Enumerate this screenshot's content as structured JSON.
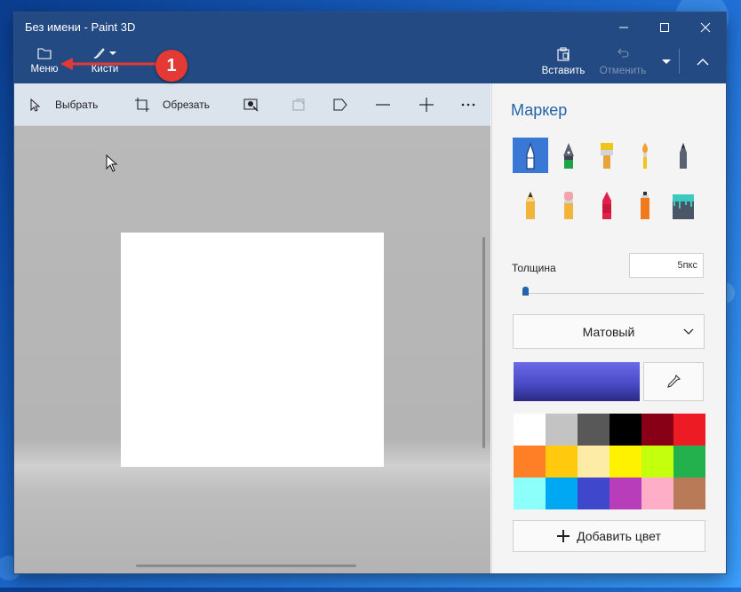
{
  "window": {
    "title": "Без имени - Paint 3D"
  },
  "ribbon": {
    "menu_label": "Меню",
    "brushes_label": "Кисти",
    "paste_label": "Вставить",
    "undo_label": "Отменить"
  },
  "toolbar": {
    "select_label": "Выбрать",
    "crop_label": "Обрезать"
  },
  "panel": {
    "title": "Маркер",
    "thickness_label": "Толщина",
    "thickness_value": "5пкс",
    "thickness_fraction": 0.02,
    "finish_value": "Матовый",
    "add_color_label": "Добавить цвет",
    "current_color": "#4b4bc7",
    "brushes": [
      {
        "name": "marker-icon",
        "selected": true
      },
      {
        "name": "calligraphy-pen-icon",
        "selected": false
      },
      {
        "name": "oil-brush-icon",
        "selected": false
      },
      {
        "name": "watercolor-icon",
        "selected": false
      },
      {
        "name": "pixel-pen-icon",
        "selected": false
      },
      {
        "name": "pencil-icon",
        "selected": false
      },
      {
        "name": "eraser-icon",
        "selected": false
      },
      {
        "name": "crayon-icon",
        "selected": false
      },
      {
        "name": "spray-can-icon",
        "selected": false
      },
      {
        "name": "fill-bucket-icon",
        "selected": false
      }
    ],
    "palette": [
      "#ffffff",
      "#c3c3c3",
      "#585858",
      "#000000",
      "#880015",
      "#ed1c24",
      "#ff7f27",
      "#ffc90e",
      "#fdeca6",
      "#fff200",
      "#c4ff0e",
      "#22b14c",
      "#8cfffb",
      "#00a8f3",
      "#3f48cc",
      "#b83dba",
      "#ffaec8",
      "#b97a57"
    ]
  },
  "annotation": {
    "number": "1",
    "color": "#e53935"
  }
}
